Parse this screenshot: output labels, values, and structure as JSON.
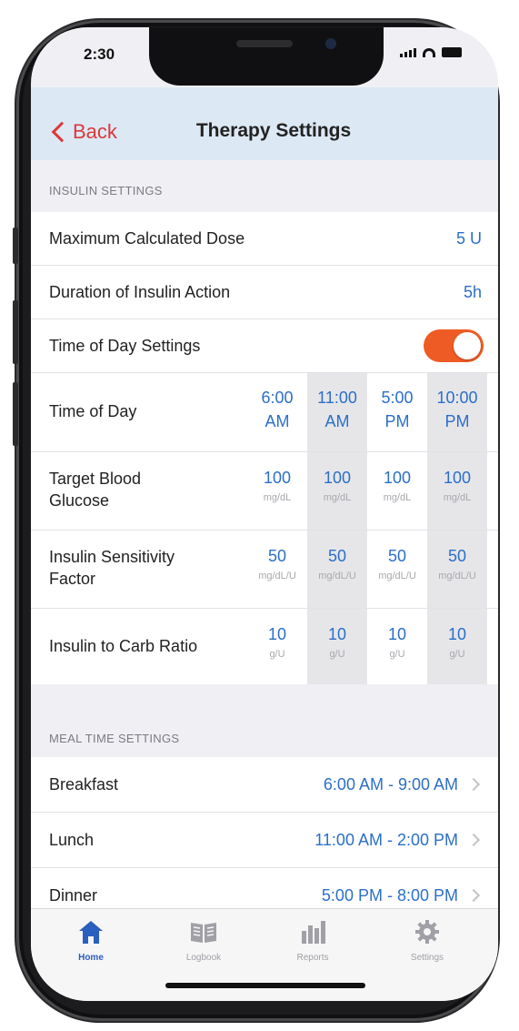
{
  "status_bar": {
    "time": "2:30"
  },
  "navbar": {
    "back_label": "Back",
    "title": "Therapy Settings"
  },
  "insulin_settings": {
    "header": "INSULIN SETTINGS",
    "max_dose": {
      "label": "Maximum Calculated Dose",
      "value": "5 U"
    },
    "duration": {
      "label": "Duration of Insulin Action",
      "value": "5h"
    },
    "time_of_day_toggle": {
      "label": "Time of Day Settings",
      "on": true
    }
  },
  "schedule": {
    "time_of_day": {
      "label": "Time of Day",
      "values": [
        "6:00 AM",
        "11:00 AM",
        "5:00 PM",
        "10:00 PM"
      ]
    },
    "target_glucose": {
      "label": "Target Blood Glucose",
      "values": [
        "100",
        "100",
        "100",
        "100"
      ],
      "unit": "mg/dL"
    },
    "sensitivity": {
      "label": "Insulin Sensitivity Factor",
      "values": [
        "50",
        "50",
        "50",
        "50"
      ],
      "unit": "mg/dL/U"
    },
    "carb_ratio": {
      "label": "Insulin to Carb Ratio",
      "values": [
        "10",
        "10",
        "10",
        "10"
      ],
      "unit": "g/U"
    }
  },
  "meal_settings": {
    "header": "MEAL TIME SETTINGS",
    "items": [
      {
        "label": "Breakfast",
        "value": "6:00 AM - 9:00 AM"
      },
      {
        "label": "Lunch",
        "value": "11:00 AM - 2:00 PM"
      },
      {
        "label": "Dinner",
        "value": "5:00 PM - 8:00 PM"
      }
    ]
  },
  "tabbar": {
    "tabs": [
      {
        "label": "Home",
        "icon": "home-icon",
        "active": true
      },
      {
        "label": "Logbook",
        "icon": "book-icon",
        "active": false
      },
      {
        "label": "Reports",
        "icon": "bar-chart-icon",
        "active": false
      },
      {
        "label": "Settings",
        "icon": "gear-icon",
        "active": false
      }
    ]
  },
  "colors": {
    "accent": "#2b6fc8",
    "back": "#d93939",
    "toggle_on": "#ef5b25",
    "active_tab": "#2b5fbf"
  }
}
